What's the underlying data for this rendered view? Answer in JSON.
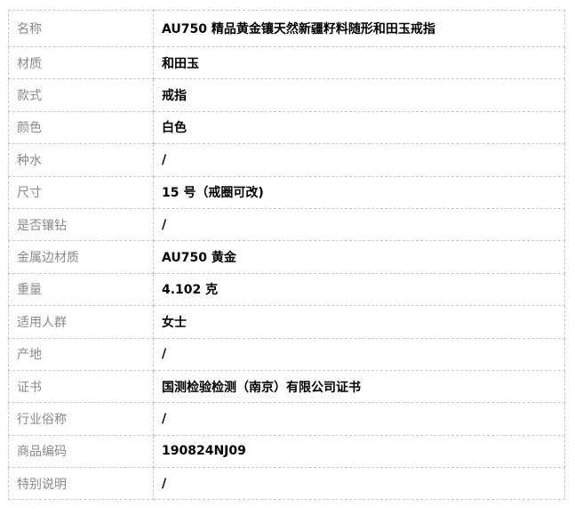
{
  "rows": [
    {
      "label": "名称",
      "value": "AU750 精品黄金镶天然新疆籽料随形和田玉戒指"
    },
    {
      "label": "材质",
      "value": "和田玉"
    },
    {
      "label": "款式",
      "value": "戒指"
    },
    {
      "label": "颜色",
      "value": "白色"
    },
    {
      "label": "种水",
      "value": "/"
    },
    {
      "label": "尺寸",
      "value": "15 号（戒圈可改)"
    },
    {
      "label": "是否镶钻",
      "value": "/"
    },
    {
      "label": "金属边材质",
      "value": "AU750 黄金"
    },
    {
      "label": "重量",
      "value": "4.102 克"
    },
    {
      "label": "适用人群",
      "value": "女士"
    },
    {
      "label": "产地",
      "value": "/"
    },
    {
      "label": "证书",
      "value": "国测检验检测（南京）有限公司证书"
    },
    {
      "label": "行业俗称",
      "value": "/"
    },
    {
      "label": "商品编码",
      "value": "190824NJ09"
    },
    {
      "label": "特别说明",
      "value": "/"
    }
  ]
}
